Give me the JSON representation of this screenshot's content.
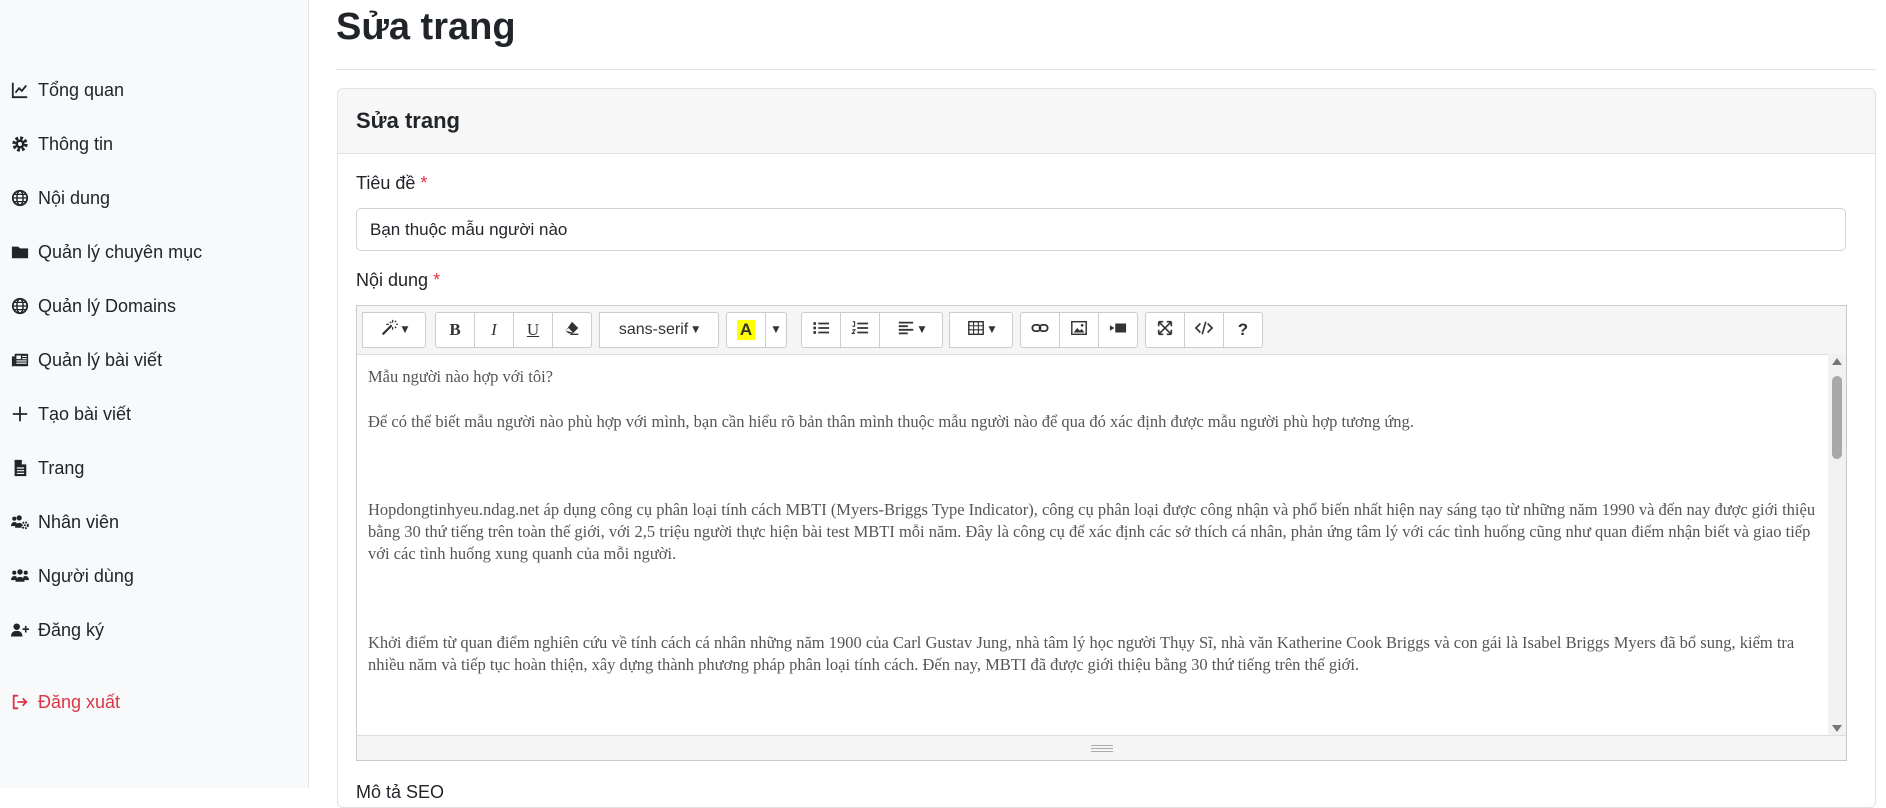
{
  "sidebar": {
    "items": [
      {
        "label": "Tổng quan",
        "icon": "chart-line-icon"
      },
      {
        "label": "Thông tin",
        "icon": "gear-icon"
      },
      {
        "label": "Nội dung",
        "icon": "globe-icon"
      },
      {
        "label": "Quản lý chuyên mục",
        "icon": "folder-icon"
      },
      {
        "label": "Quản lý Domains",
        "icon": "globe-icon"
      },
      {
        "label": "Quản lý bài viết",
        "icon": "newspaper-icon"
      },
      {
        "label": "Tạo bài viết",
        "icon": "plus-icon"
      },
      {
        "label": "Trang",
        "icon": "file-icon"
      },
      {
        "label": "Nhân viên",
        "icon": "users-cog-icon"
      },
      {
        "label": "Người dùng",
        "icon": "users-icon"
      },
      {
        "label": "Đăng ký",
        "icon": "user-plus-icon"
      }
    ],
    "logout": {
      "label": "Đăng xuất",
      "icon": "sign-out-icon",
      "color": "#dc3545"
    }
  },
  "page": {
    "title": "Sửa trang"
  },
  "card": {
    "header": "Sửa trang",
    "title_label": "Tiêu đề",
    "required_mark": "*",
    "title_value": "Bạn thuộc mẫu người nào",
    "content_label": "Nội dung",
    "seo_label": "Mô tả SEO"
  },
  "editor": {
    "font_name": "sans-serif",
    "highlight_letter": "A",
    "highlight_color": "#ffff00",
    "paragraphs": [
      "Mẫu người nào hợp với tôi?",
      "Để có thể biết mẫu người nào phù hợp với mình, bạn cần hiểu rõ bản thân mình thuộc mẫu người nào để qua đó xác định được mẫu người phù hợp tương ứng.",
      "Hopdongtinhyeu.ndag.net áp dụng công cụ phân loại tính cách MBTI (Myers-Briggs Type Indicator), công cụ phân loại được công nhận và phổ biến nhất hiện nay sáng tạo từ những năm 1990 và đến nay được giới thiệu bằng 30 thứ tiếng trên toàn thế giới, với 2,5 triệu người thực hiện bài test MBTI mỗi năm. Đây là công cụ để xác định các sở thích cá nhân, phản ứng tâm lý với các tình huống cũng như quan điểm nhận biết và giao tiếp với các tình huống xung quanh của mỗi người.",
      "Khởi điểm từ quan điểm nghiên cứu về tính cách cá nhân những năm 1900 của Carl Gustav Jung, nhà tâm lý học người Thụy Sĩ, nhà văn Katherine Cook Briggs và con gái là Isabel Briggs Myers đã bổ sung, kiểm tra nhiều năm và tiếp tục hoàn thiện, xây dựng thành phương pháp phân loại tính cách. Đến nay, MBTI đã được giới thiệu bằng 30 thứ tiếng trên thế giới."
    ]
  }
}
